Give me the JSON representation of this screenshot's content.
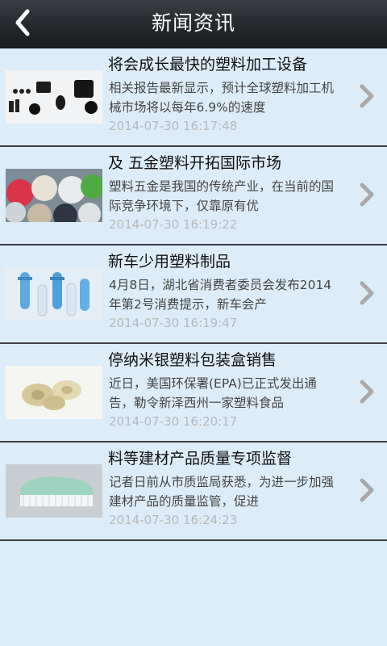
{
  "header": {
    "title": "新闻资讯",
    "back_icon": "chevron-left-icon"
  },
  "news": [
    {
      "title": "将会成长最快的塑料加工设备",
      "summary": "相关报告最新显示，预计全球塑料加工机械市场将以每年6.9%的速度",
      "date": "2014-07-30 16:17:48",
      "image": "plastic-parts-photo"
    },
    {
      "title": "及 五金塑料开拓国际市场",
      "summary": "塑料五金是我国的传统产业，在当前的国际竞争环境下，仅靠原有优",
      "date": "2014-07-30 16:19:22",
      "image": "plastic-beads-photo"
    },
    {
      "title": "新车少用塑料制品",
      "summary": "4月8日，湖北省消费者委员会发布2014年第2号消费提示，新车会产",
      "date": "2014-07-30 16:19:47",
      "image": "plastic-preforms-photo"
    },
    {
      "title": "停纳米银塑料包装盒销售",
      "summary": "近日，美国环保署(EPA)已正式发出通告，勒令新泽西州一家塑料食品",
      "date": "2014-07-30 16:20:17",
      "image": "plastic-spools-photo"
    },
    {
      "title": "料等建材产品质量专项监督",
      "summary": "记者日前从市质监局获悉，为进一步加强建材产品的质量监管，促进",
      "date": "2014-07-30 16:24:23",
      "image": "plastic-brush-photo"
    }
  ],
  "colors": {
    "background": "#d9edf9",
    "header": "#25282c",
    "date_text": "#b8b8b8",
    "chevron": "#a9a9a9"
  }
}
